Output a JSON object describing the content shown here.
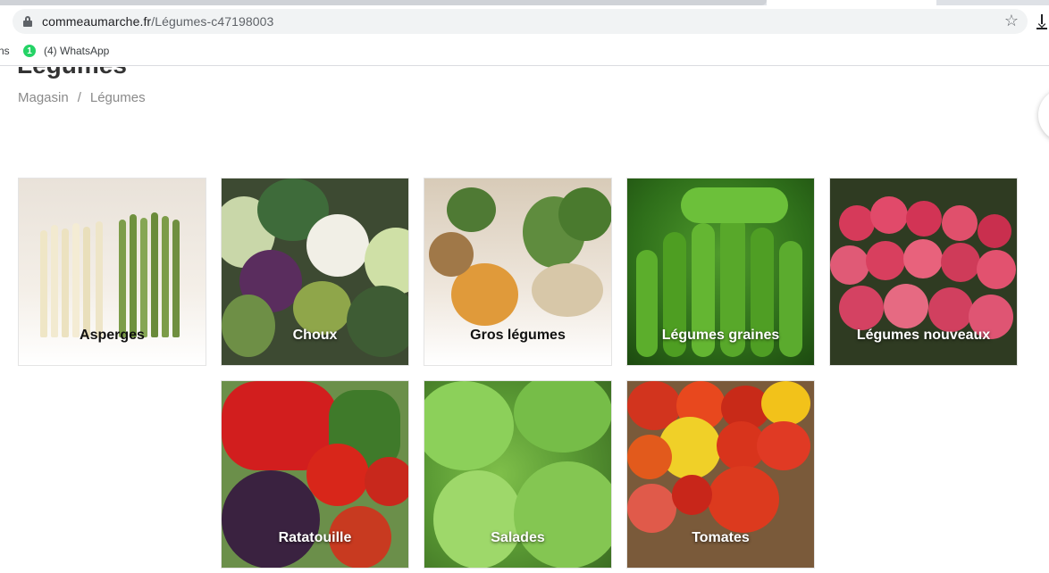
{
  "browser": {
    "url_domain": "commeaumarche.fr",
    "url_path": "/Légumes-c47198003",
    "bookmarks": {
      "apps_label": "ns",
      "whatsapp_badge": "1",
      "whatsapp_label": "(4) WhatsApp"
    }
  },
  "page": {
    "title": "Légumes",
    "breadcrumb": [
      "Magasin",
      "/",
      "Légumes"
    ]
  },
  "categories": [
    {
      "label": "Asperges"
    },
    {
      "label": "Choux"
    },
    {
      "label": "Gros légumes"
    },
    {
      "label": "Légumes graines"
    },
    {
      "label": "Légumes nouveaux"
    },
    {
      "label": "Ratatouille"
    },
    {
      "label": "Salades"
    },
    {
      "label": "Tomates"
    }
  ],
  "colors": {
    "accent_green": "#25d366",
    "text_dark": "#333333",
    "breadcrumb_grey": "#8a8a8a"
  }
}
